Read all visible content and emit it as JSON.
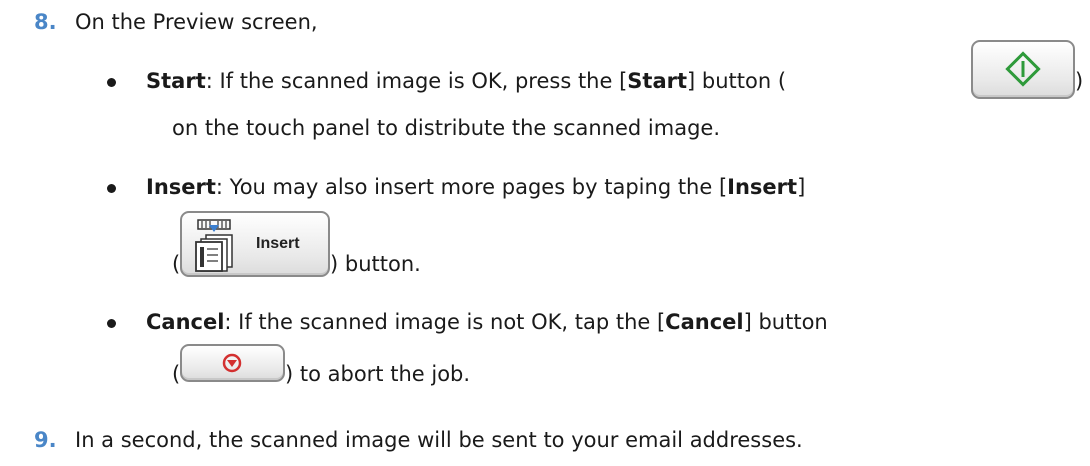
{
  "step8": {
    "number": "8.",
    "text": "On the Preview screen,"
  },
  "bullets": {
    "start": {
      "term": "Start",
      "text_before": ": If the scanned image is OK, press the [",
      "bold_in_text": "Start",
      "text_after": "] button (",
      "close_paren": ")",
      "line2": "on the touch panel to distribute the scanned image."
    },
    "insert": {
      "term": "Insert",
      "text_before": ": You may also insert more pages by taping the [",
      "bold_in_text": "Insert",
      "text_after": "]",
      "open_paren": "(",
      "button_label": "Insert",
      "line2": ") button."
    },
    "cancel": {
      "term": "Cancel",
      "text_before": ": If the scanned image is not OK, tap the [",
      "bold_in_text": "Cancel",
      "text_after": "] button",
      "open_paren": "(",
      "line2": ") to abort the job."
    }
  },
  "step9": {
    "number": "9.",
    "text": "In a second, the scanned image will be sent to your email addresses."
  },
  "colors": {
    "step_number": "#4a86c7",
    "start_icon": "#2e9a3a",
    "cancel_icon": "#d33030"
  },
  "icons": {
    "start": "start-diamond-icon",
    "insert": "insert-pages-icon",
    "cancel": "cancel-stop-icon"
  }
}
